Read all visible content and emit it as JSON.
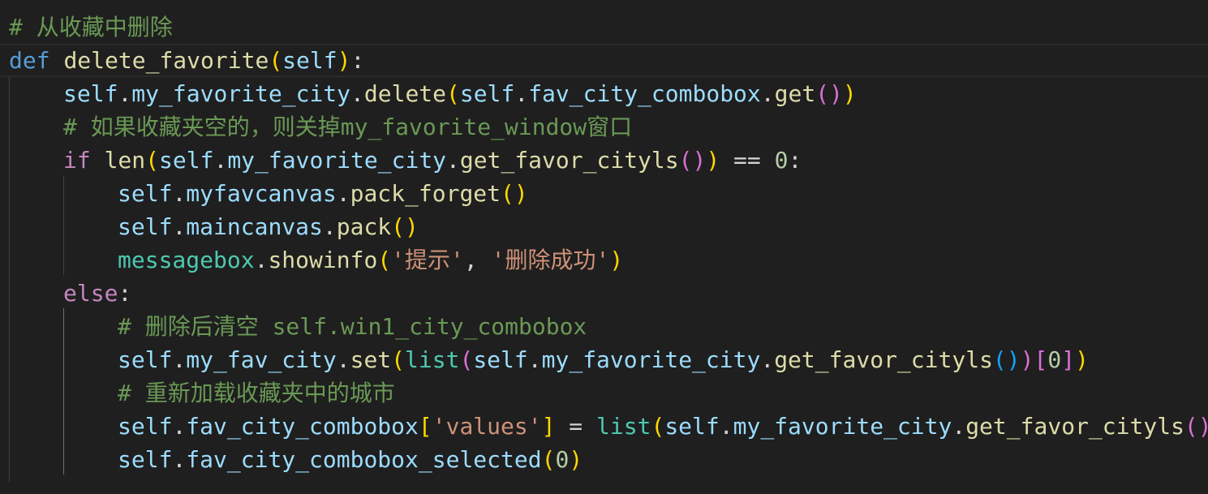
{
  "editor": {
    "lines": [
      {
        "indent": 0,
        "tokens": [
          {
            "t": "# 从收藏中删除",
            "c": "t-comment"
          }
        ]
      },
      {
        "indent": 0,
        "current": true,
        "tokens": [
          {
            "t": "def",
            "c": "t-kw"
          },
          {
            "t": " ",
            "c": "t-op"
          },
          {
            "t": "delete_favorite",
            "c": "t-fn"
          },
          {
            "t": "(",
            "c": "b1"
          },
          {
            "t": "self",
            "c": "t-var"
          },
          {
            "t": ")",
            "c": "b1"
          },
          {
            "t": ":",
            "c": "t-op"
          }
        ]
      },
      {
        "indent": 1,
        "tokens": [
          {
            "t": "self",
            "c": "t-var"
          },
          {
            "t": ".",
            "c": "t-op"
          },
          {
            "t": "my_favorite_city",
            "c": "t-var"
          },
          {
            "t": ".",
            "c": "t-op"
          },
          {
            "t": "delete",
            "c": "t-fn"
          },
          {
            "t": "(",
            "c": "b1"
          },
          {
            "t": "self",
            "c": "t-var"
          },
          {
            "t": ".",
            "c": "t-op"
          },
          {
            "t": "fav_city_combobox",
            "c": "t-var"
          },
          {
            "t": ".",
            "c": "t-op"
          },
          {
            "t": "get",
            "c": "t-fn"
          },
          {
            "t": "()",
            "c": "b2"
          },
          {
            "t": ")",
            "c": "b1"
          }
        ]
      },
      {
        "indent": 1,
        "tokens": [
          {
            "t": "# 如果收藏夹空的，则关掉my_favorite_window窗口",
            "c": "t-comment"
          }
        ]
      },
      {
        "indent": 1,
        "tokens": [
          {
            "t": "if",
            "c": "t-flow"
          },
          {
            "t": " ",
            "c": "t-op"
          },
          {
            "t": "len",
            "c": "t-fn"
          },
          {
            "t": "(",
            "c": "b1"
          },
          {
            "t": "self",
            "c": "t-var"
          },
          {
            "t": ".",
            "c": "t-op"
          },
          {
            "t": "my_favorite_city",
            "c": "t-var"
          },
          {
            "t": ".",
            "c": "t-op"
          },
          {
            "t": "get_favor_cityls",
            "c": "t-fn"
          },
          {
            "t": "()",
            "c": "b2"
          },
          {
            "t": ")",
            "c": "b1"
          },
          {
            "t": " == ",
            "c": "t-op"
          },
          {
            "t": "0",
            "c": "t-num"
          },
          {
            "t": ":",
            "c": "t-op"
          }
        ]
      },
      {
        "indent": 2,
        "tokens": [
          {
            "t": "self",
            "c": "t-var"
          },
          {
            "t": ".",
            "c": "t-op"
          },
          {
            "t": "myfavcanvas",
            "c": "t-var"
          },
          {
            "t": ".",
            "c": "t-op"
          },
          {
            "t": "pack_forget",
            "c": "t-fn"
          },
          {
            "t": "()",
            "c": "b1"
          }
        ]
      },
      {
        "indent": 2,
        "tokens": [
          {
            "t": "self",
            "c": "t-var"
          },
          {
            "t": ".",
            "c": "t-op"
          },
          {
            "t": "maincanvas",
            "c": "t-var"
          },
          {
            "t": ".",
            "c": "t-op"
          },
          {
            "t": "pack",
            "c": "t-fn"
          },
          {
            "t": "()",
            "c": "b1"
          }
        ]
      },
      {
        "indent": 2,
        "tokens": [
          {
            "t": "messagebox",
            "c": "t-cls"
          },
          {
            "t": ".",
            "c": "t-op"
          },
          {
            "t": "showinfo",
            "c": "t-fn"
          },
          {
            "t": "(",
            "c": "b1"
          },
          {
            "t": "'提示'",
            "c": "t-str"
          },
          {
            "t": ", ",
            "c": "t-op"
          },
          {
            "t": "'删除成功'",
            "c": "t-str"
          },
          {
            "t": ")",
            "c": "b1"
          }
        ]
      },
      {
        "indent": 1,
        "tokens": [
          {
            "t": "else",
            "c": "t-flow"
          },
          {
            "t": ":",
            "c": "t-op"
          }
        ]
      },
      {
        "indent": 2,
        "tokens": [
          {
            "t": "# 删除后清空 self.win1_city_combobox",
            "c": "t-comment"
          }
        ]
      },
      {
        "indent": 2,
        "tokens": [
          {
            "t": "self",
            "c": "t-var"
          },
          {
            "t": ".",
            "c": "t-op"
          },
          {
            "t": "my_fav_city",
            "c": "t-var"
          },
          {
            "t": ".",
            "c": "t-op"
          },
          {
            "t": "set",
            "c": "t-fn"
          },
          {
            "t": "(",
            "c": "b1"
          },
          {
            "t": "list",
            "c": "t-cls"
          },
          {
            "t": "(",
            "c": "b2"
          },
          {
            "t": "self",
            "c": "t-var"
          },
          {
            "t": ".",
            "c": "t-op"
          },
          {
            "t": "my_favorite_city",
            "c": "t-var"
          },
          {
            "t": ".",
            "c": "t-op"
          },
          {
            "t": "get_favor_cityls",
            "c": "t-fn"
          },
          {
            "t": "()",
            "c": "b3"
          },
          {
            "t": ")",
            "c": "b2"
          },
          {
            "t": "[",
            "c": "b2"
          },
          {
            "t": "0",
            "c": "t-num"
          },
          {
            "t": "]",
            "c": "b2"
          },
          {
            "t": ")",
            "c": "b1"
          }
        ]
      },
      {
        "indent": 2,
        "tokens": [
          {
            "t": "# 重新加载收藏夹中的城市",
            "c": "t-comment"
          }
        ]
      },
      {
        "indent": 2,
        "tokens": [
          {
            "t": "self",
            "c": "t-var"
          },
          {
            "t": ".",
            "c": "t-op"
          },
          {
            "t": "fav_city_combobox",
            "c": "t-var"
          },
          {
            "t": "[",
            "c": "b1"
          },
          {
            "t": "'values'",
            "c": "t-str"
          },
          {
            "t": "]",
            "c": "b1"
          },
          {
            "t": " = ",
            "c": "t-op"
          },
          {
            "t": "list",
            "c": "t-cls"
          },
          {
            "t": "(",
            "c": "b1"
          },
          {
            "t": "self",
            "c": "t-var"
          },
          {
            "t": ".",
            "c": "t-op"
          },
          {
            "t": "my_favorite_city",
            "c": "t-var"
          },
          {
            "t": ".",
            "c": "t-op"
          },
          {
            "t": "get_favor_cityls",
            "c": "t-fn"
          },
          {
            "t": "()",
            "c": "b2"
          },
          {
            "t": ")",
            "c": "b1"
          }
        ]
      },
      {
        "indent": 2,
        "tokens": [
          {
            "t": "self",
            "c": "t-var"
          },
          {
            "t": ".",
            "c": "t-op"
          },
          {
            "t": "fav_city_combobox_selected",
            "c": "t-var"
          },
          {
            "t": "(",
            "c": "b1"
          },
          {
            "t": "0",
            "c": "t-num"
          },
          {
            "t": ")",
            "c": "b1"
          }
        ]
      }
    ]
  }
}
